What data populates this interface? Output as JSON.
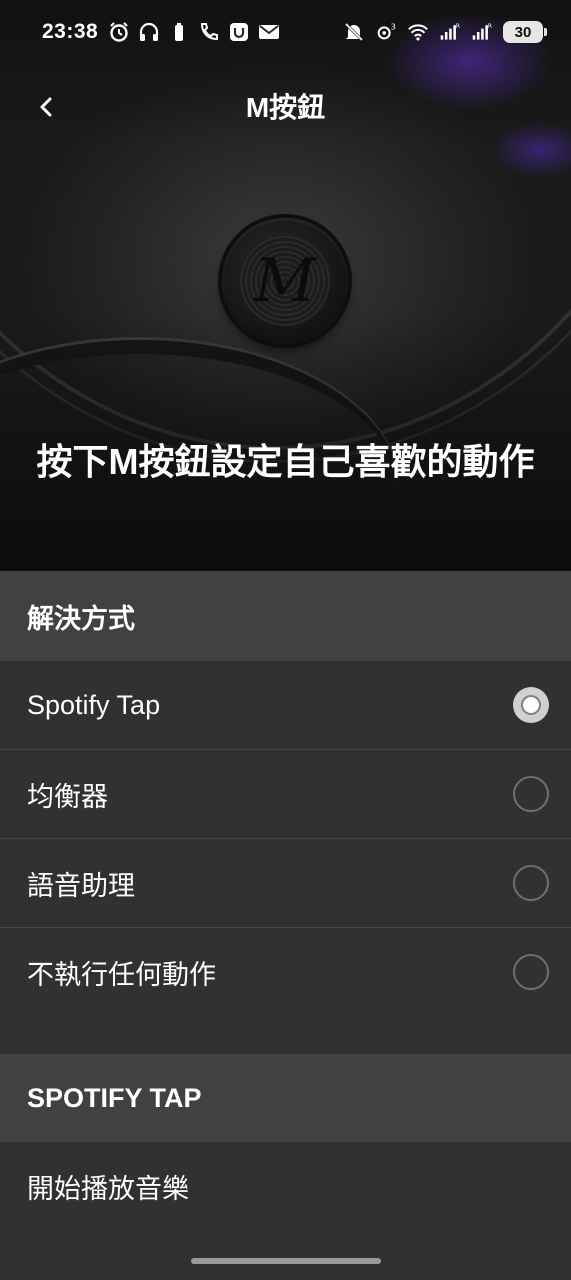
{
  "status_bar": {
    "time": "23:38",
    "battery": "30",
    "left_icons": [
      "alarm-icon",
      "headphones-icon",
      "wifi-calling-icon",
      "app-notification-icon",
      "mail-icon"
    ],
    "right_icons": [
      "mute-icon",
      "hotspot-icon",
      "wifi-icon",
      "signal-icon",
      "signal-icon"
    ]
  },
  "app_bar": {
    "title": "M按鈕"
  },
  "hero": {
    "heading": "按下M按鈕設定自己喜歡的動作"
  },
  "sections": {
    "solution": {
      "header": "解決方式",
      "options": [
        {
          "label": "Spotify Tap",
          "selected": true
        },
        {
          "label": "均衡器",
          "selected": false
        },
        {
          "label": "語音助理",
          "selected": false
        },
        {
          "label": "不執行任何動作",
          "selected": false
        }
      ]
    },
    "spotify_tap": {
      "header": "SPOTIFY TAP",
      "item": "開始播放音樂"
    }
  },
  "colors": {
    "background": "#2f3133",
    "section_header": "#3f4143",
    "divider": "#45474a",
    "radio_selected": "#cfd0d1"
  }
}
